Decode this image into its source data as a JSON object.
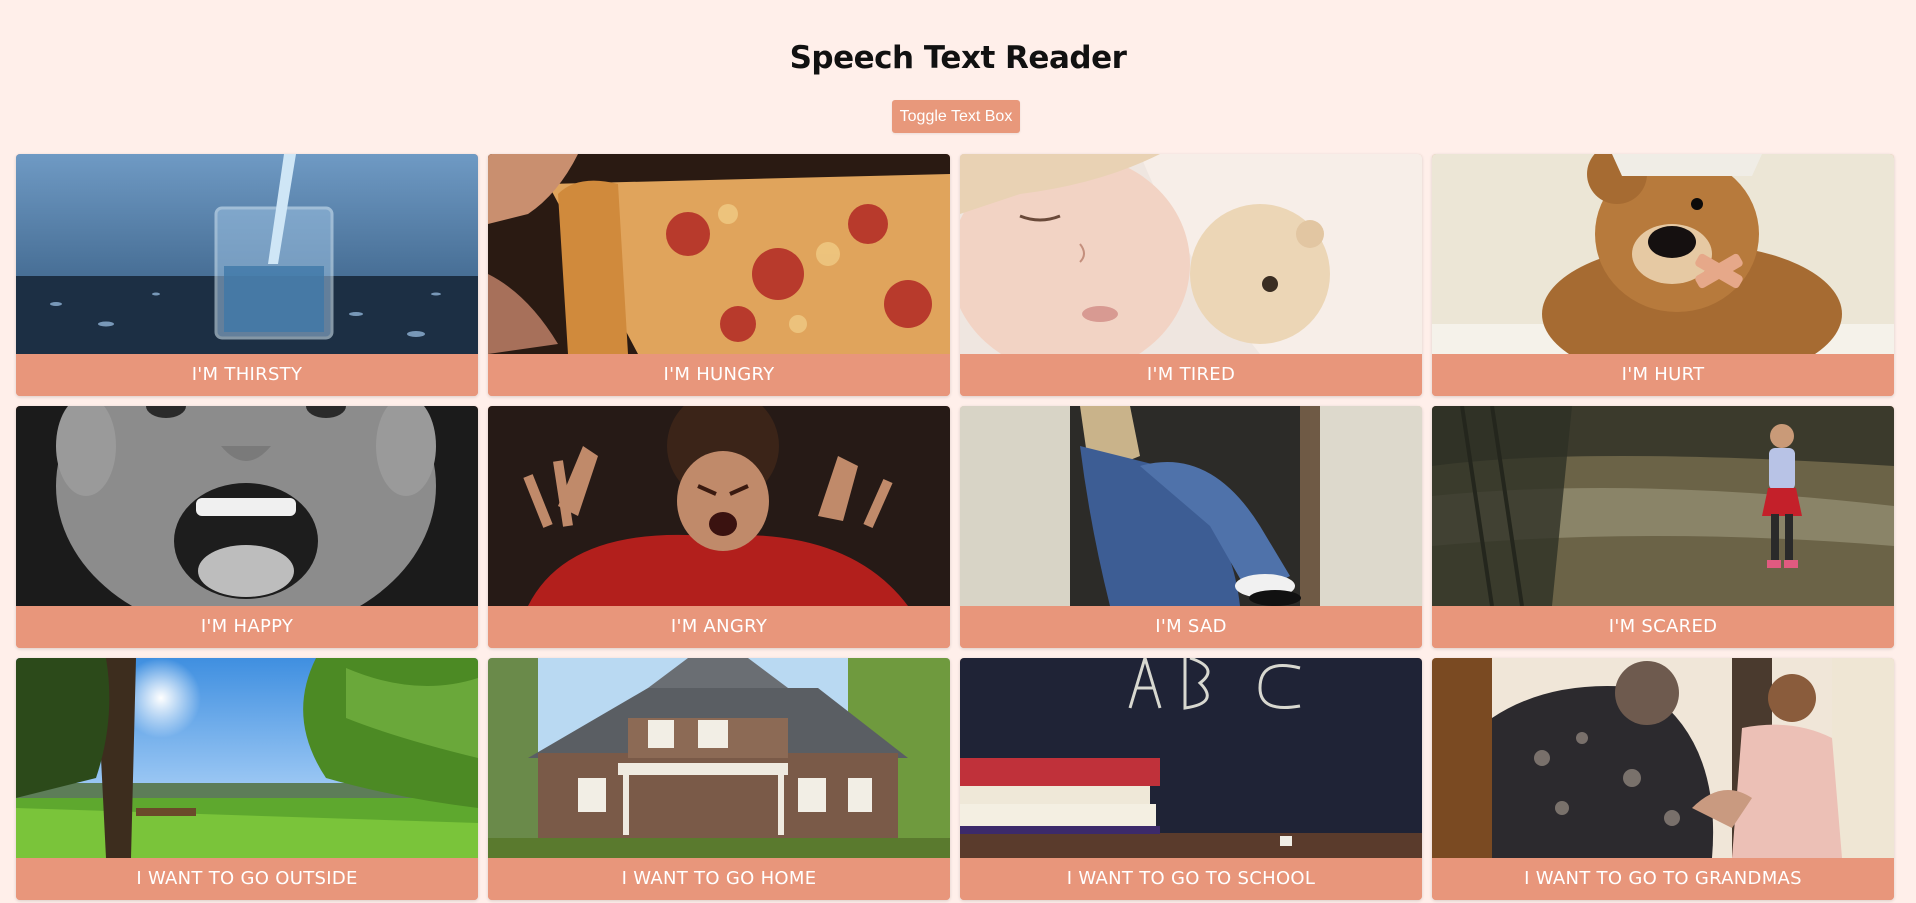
{
  "header": {
    "title": "Speech Text Reader",
    "toggle_label": "Toggle Text Box"
  },
  "cards": [
    {
      "label": "I'M THIRSTY",
      "image": "glass-of-water-image"
    },
    {
      "label": "I'M HUNGRY",
      "image": "pizza-slice-image"
    },
    {
      "label": "I'M TIRED",
      "image": "sleeping-child-image"
    },
    {
      "label": "I'M HURT",
      "image": "bandaged-teddy-bear-image"
    },
    {
      "label": "I'M HAPPY",
      "image": "laughing-boy-image"
    },
    {
      "label": "I'M ANGRY",
      "image": "angry-boy-image"
    },
    {
      "label": "I'M SAD",
      "image": "sad-child-image"
    },
    {
      "label": "I'M SCARED",
      "image": "scared-girl-image"
    },
    {
      "label": "I WANT TO GO OUTSIDE",
      "image": "sunny-park-image"
    },
    {
      "label": "I WANT TO GO HOME",
      "image": "house-image"
    },
    {
      "label": "I WANT TO GO TO SCHOOL",
      "image": "chalkboard-books-image"
    },
    {
      "label": "I WANT TO GO TO GRANDMAS",
      "image": "grandma-child-image"
    }
  ]
}
